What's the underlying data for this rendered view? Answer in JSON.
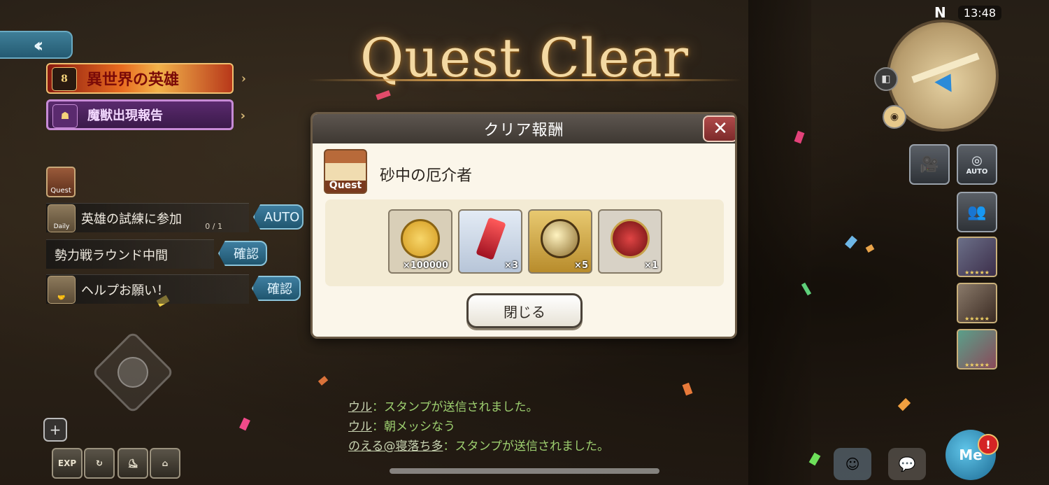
{
  "title": "Quest Clear",
  "clock": "13:48",
  "compass": "N",
  "left_panel": {
    "banner_event": "異世界の英雄",
    "banner_event_badge": "8",
    "banner_report": "魔獣出現報告",
    "quest_icon_label": "Quest",
    "tasks": [
      {
        "icon_label": "Daily",
        "label": "英雄の試練に参加",
        "progress": "0 / 1",
        "button": "AUTO"
      },
      {
        "label": "勢力戦ラウンド中間",
        "button": "確認"
      },
      {
        "label": "ヘルプお願い！",
        "button": "確認"
      }
    ],
    "bottom_icons": [
      "EXP",
      "",
      "",
      ""
    ]
  },
  "right_panel": {
    "auto_label": "AUTO",
    "rarity_stars": "★★★★★"
  },
  "dialog": {
    "header": "クリア報酬",
    "close_glyph": "✕",
    "quest_icon_label": "Quest",
    "quest_name": "砂中の厄介者",
    "rewards": [
      {
        "name": "gold-coin",
        "quantity": "×100000",
        "bg": "#d9cfb8",
        "color": "#e1b53a"
      },
      {
        "name": "red-crystal",
        "quantity": "×3",
        "bg": "#cfd9e6",
        "color": "#c0202a"
      },
      {
        "name": "gold-orb",
        "quantity": "×5",
        "bg": "#cfae4e",
        "color": "#7c6328"
      },
      {
        "name": "demon-emblem",
        "quantity": "×1",
        "bg": "#d8d2c6",
        "color": "#b62c2c"
      }
    ],
    "close_button": "閉じる"
  },
  "chat": [
    {
      "name": "ウル",
      "message": "：スタンプが送信されました。"
    },
    {
      "name": "ウル",
      "message": "：朝メッシなう"
    },
    {
      "name": "のえる@寝落ち多",
      "message": "：スタンプが送信されました。"
    }
  ],
  "me_badge": "Me",
  "alert": "!"
}
